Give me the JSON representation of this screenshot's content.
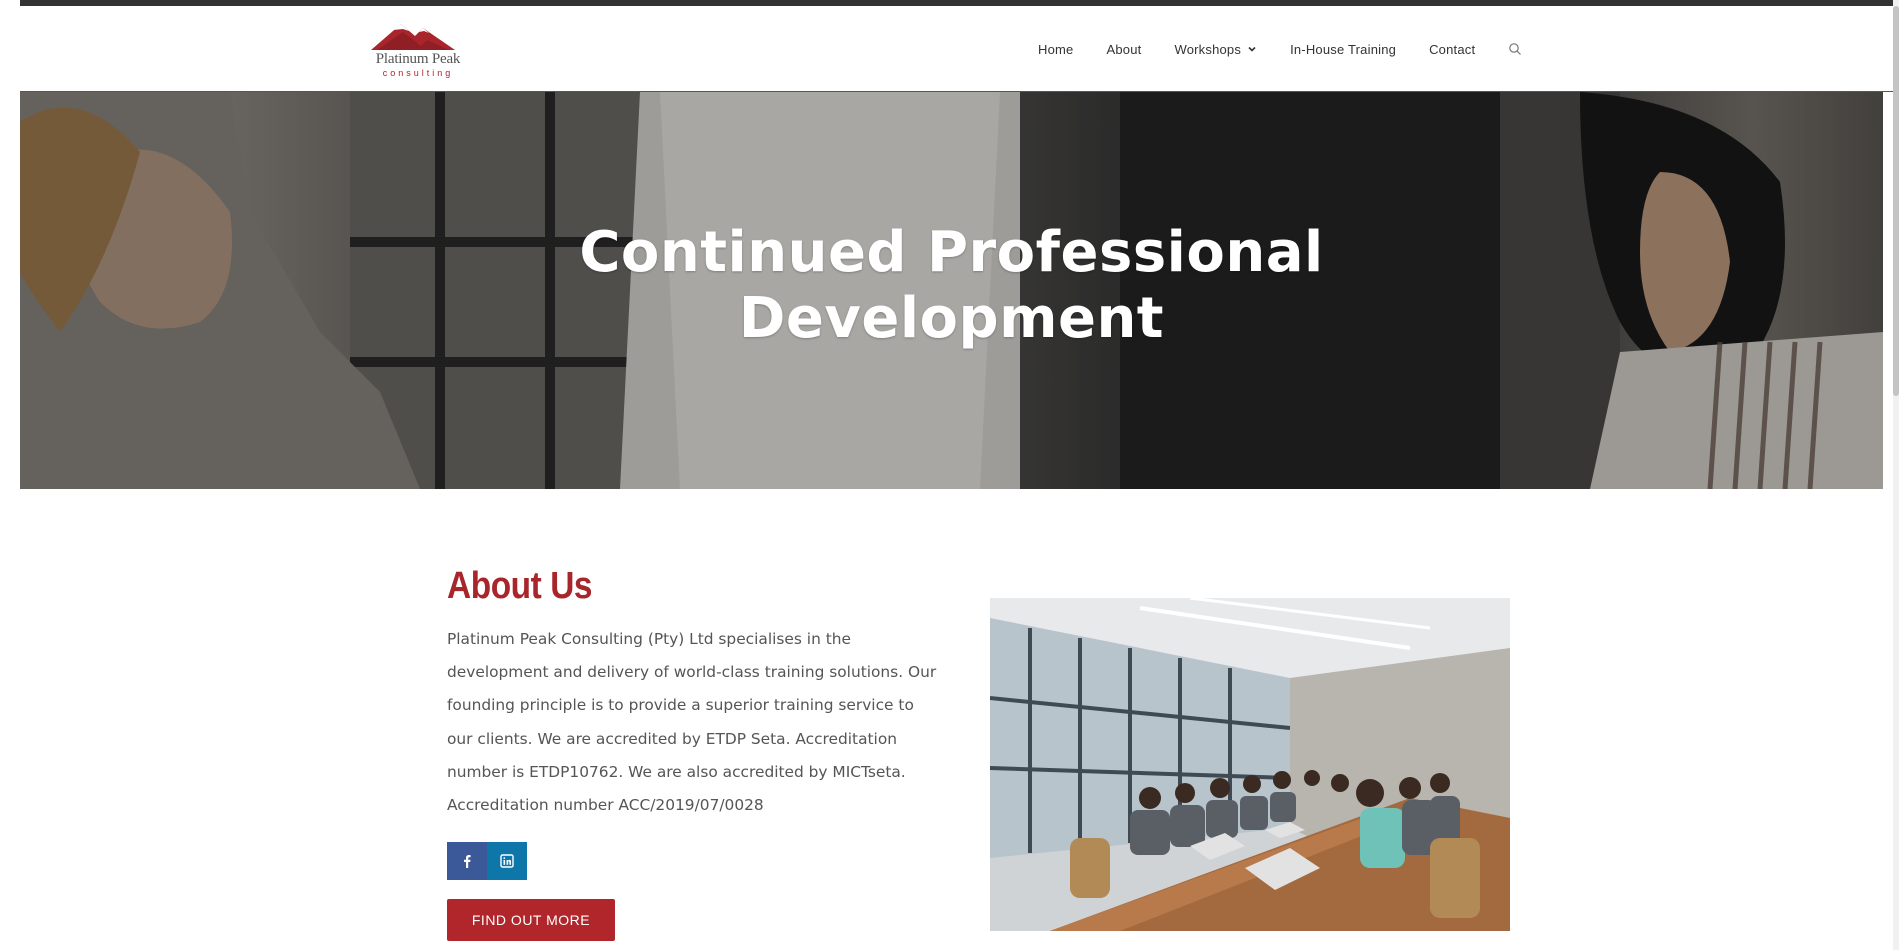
{
  "brand": {
    "name": "Platinum Peak",
    "tagline": "consulting",
    "colors": {
      "accent": "#a8262b",
      "facebook": "#3b5998",
      "linkedin": "#0e76a8"
    }
  },
  "nav": {
    "items": [
      {
        "label": "Home"
      },
      {
        "label": "About"
      },
      {
        "label": "Workshops",
        "icon": "chevron-down-icon"
      },
      {
        "label": "In-House Training"
      },
      {
        "label": "Contact"
      }
    ],
    "search_icon": "search-icon"
  },
  "hero": {
    "title_line1": "Continued Professional",
    "title_line2": "Development"
  },
  "about": {
    "heading": "About Us",
    "body": "Platinum Peak Consulting (Pty) Ltd specialises in the development and delivery of world-class training solutions. Our founding principle is to provide a superior training service to our clients. We are accredited by ETDP Seta. Accreditation number is ETDP10762. We are also accredited by MICTseta. Accreditation number ACC/2019/07/0028",
    "social": [
      {
        "network": "facebook",
        "icon": "facebook-icon"
      },
      {
        "network": "linkedin",
        "icon": "linkedin-icon"
      }
    ],
    "cta_label": "FIND OUT MORE"
  }
}
